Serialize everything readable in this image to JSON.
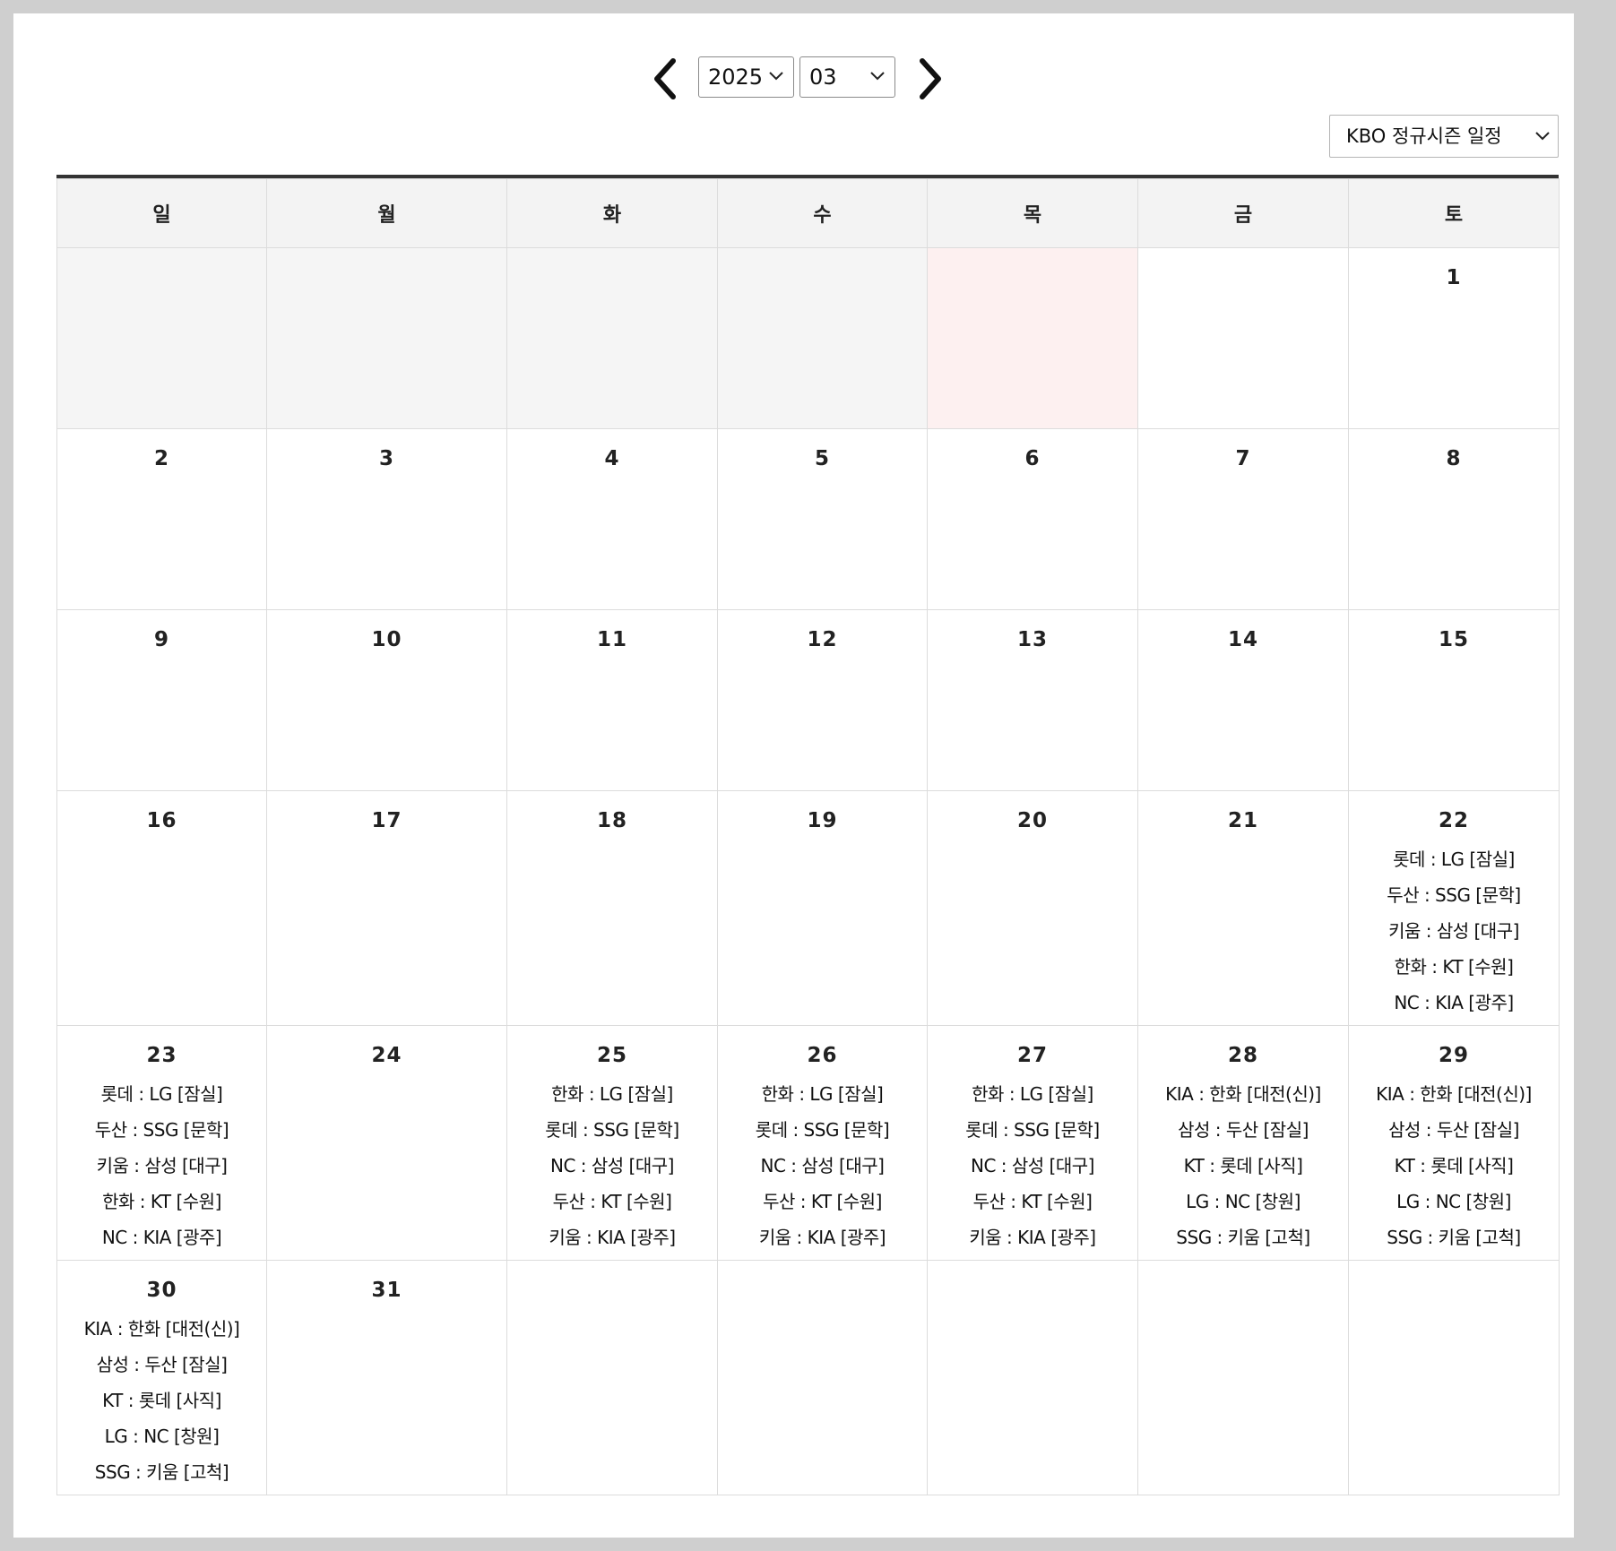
{
  "nav": {
    "year": "2025",
    "month": "03",
    "schedule_type": "KBO 정규시즌 일정"
  },
  "weekdays": [
    "일",
    "월",
    "화",
    "수",
    "목",
    "금",
    "토"
  ],
  "weeks": [
    [
      {
        "type": "empty"
      },
      {
        "type": "empty"
      },
      {
        "type": "empty"
      },
      {
        "type": "empty"
      },
      {
        "type": "today"
      },
      {
        "type": "blank"
      },
      {
        "day": "1",
        "games": []
      }
    ],
    [
      {
        "day": "2",
        "games": []
      },
      {
        "day": "3",
        "games": []
      },
      {
        "day": "4",
        "games": []
      },
      {
        "day": "5",
        "games": []
      },
      {
        "day": "6",
        "games": []
      },
      {
        "day": "7",
        "games": []
      },
      {
        "day": "8",
        "games": []
      }
    ],
    [
      {
        "day": "9",
        "games": []
      },
      {
        "day": "10",
        "games": []
      },
      {
        "day": "11",
        "games": []
      },
      {
        "day": "12",
        "games": []
      },
      {
        "day": "13",
        "games": []
      },
      {
        "day": "14",
        "games": []
      },
      {
        "day": "15",
        "games": []
      }
    ],
    [
      {
        "day": "16",
        "games": []
      },
      {
        "day": "17",
        "games": []
      },
      {
        "day": "18",
        "games": []
      },
      {
        "day": "19",
        "games": []
      },
      {
        "day": "20",
        "games": []
      },
      {
        "day": "21",
        "games": []
      },
      {
        "day": "22",
        "games": [
          "롯데 : LG [잠실]",
          "두산 : SSG [문학]",
          "키움 : 삼성 [대구]",
          "한화 : KT [수원]",
          "NC : KIA [광주]"
        ]
      }
    ],
    [
      {
        "day": "23",
        "games": [
          "롯데 : LG [잠실]",
          "두산 : SSG [문학]",
          "키움 : 삼성 [대구]",
          "한화 : KT [수원]",
          "NC : KIA [광주]"
        ]
      },
      {
        "day": "24",
        "games": []
      },
      {
        "day": "25",
        "games": [
          "한화 : LG [잠실]",
          "롯데 : SSG [문학]",
          "NC : 삼성 [대구]",
          "두산 : KT [수원]",
          "키움 : KIA [광주]"
        ]
      },
      {
        "day": "26",
        "games": [
          "한화 : LG [잠실]",
          "롯데 : SSG [문학]",
          "NC : 삼성 [대구]",
          "두산 : KT [수원]",
          "키움 : KIA [광주]"
        ]
      },
      {
        "day": "27",
        "games": [
          "한화 : LG [잠실]",
          "롯데 : SSG [문학]",
          "NC : 삼성 [대구]",
          "두산 : KT [수원]",
          "키움 : KIA [광주]"
        ]
      },
      {
        "day": "28",
        "games": [
          "KIA : 한화 [대전(신)]",
          "삼성 : 두산 [잠실]",
          "KT : 롯데 [사직]",
          "LG : NC [창원]",
          "SSG : 키움 [고척]"
        ]
      },
      {
        "day": "29",
        "games": [
          "KIA : 한화 [대전(신)]",
          "삼성 : 두산 [잠실]",
          "KT : 롯데 [사직]",
          "LG : NC [창원]",
          "SSG : 키움 [고척]"
        ]
      }
    ],
    [
      {
        "day": "30",
        "games": [
          "KIA : 한화 [대전(신)]",
          "삼성 : 두산 [잠실]",
          "KT : 롯데 [사직]",
          "LG : NC [창원]",
          "SSG : 키움 [고척]"
        ]
      },
      {
        "day": "31",
        "games": []
      },
      {
        "type": "blank"
      },
      {
        "type": "blank"
      },
      {
        "type": "blank"
      },
      {
        "type": "blank"
      },
      {
        "type": "blank"
      }
    ]
  ]
}
